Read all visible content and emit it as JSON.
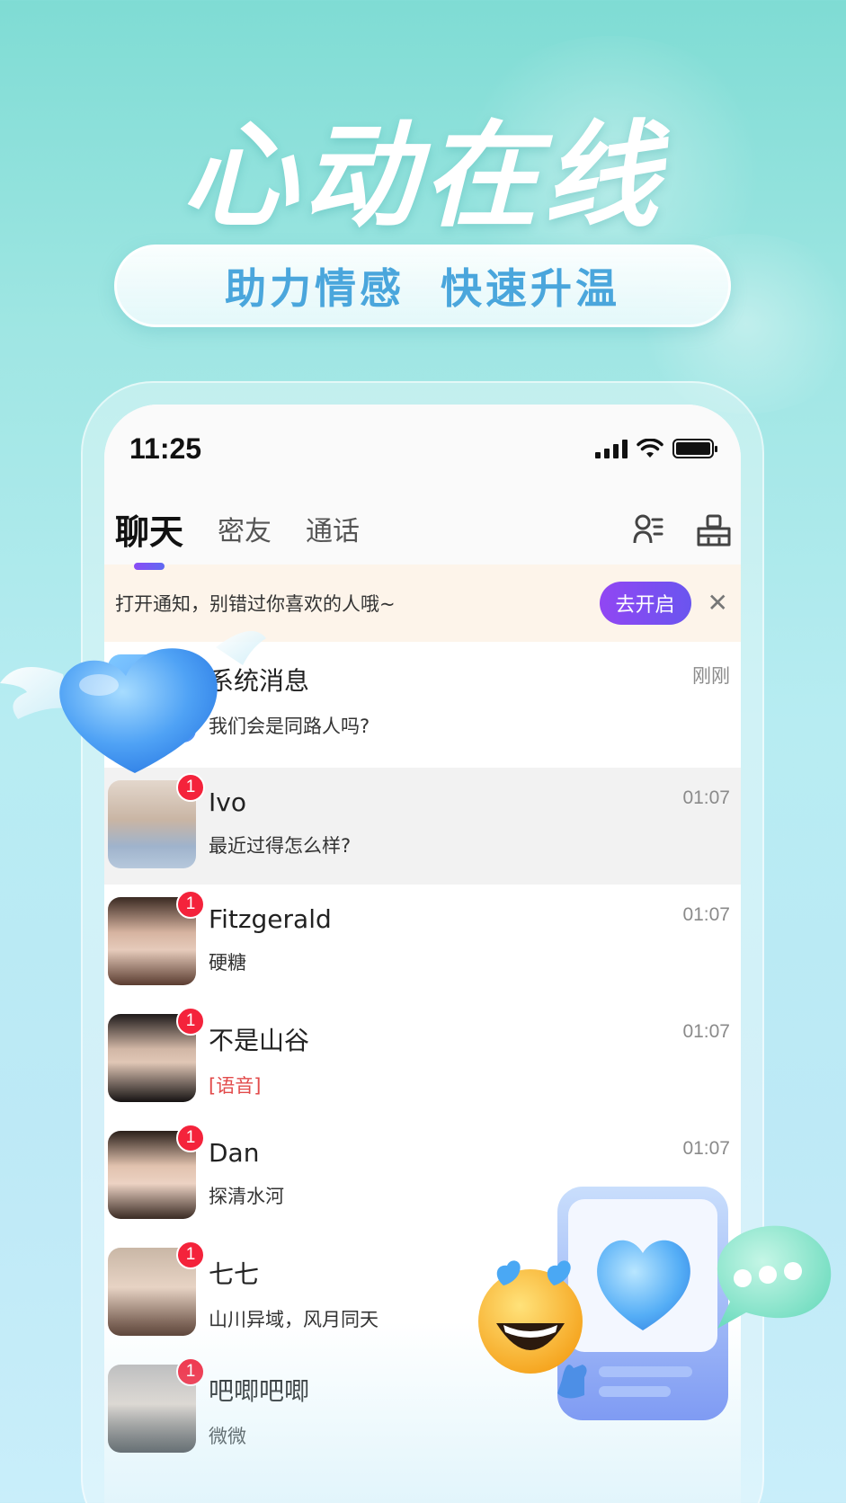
{
  "banner": {
    "headline": "心动在线",
    "subtitle": "助力情感  快速升温"
  },
  "status_bar": {
    "time": "11:25"
  },
  "tabs": [
    {
      "label": "聊天",
      "active": true
    },
    {
      "label": "密友",
      "active": false
    },
    {
      "label": "通话",
      "active": false
    }
  ],
  "tab_icons": [
    "contacts-icon",
    "broom-icon"
  ],
  "notify_bar": {
    "text": "打开通知，别错过你喜欢的人哦~",
    "button_label": "去开启",
    "close_icon": "close-icon"
  },
  "system_message": {
    "title": "系统消息",
    "message": "我们会是同路人吗?",
    "time": "刚刚"
  },
  "conversations": [
    {
      "name": "Ivo",
      "message": "最近过得怎么样?",
      "time": "01:07",
      "badge": "1"
    },
    {
      "name": "Fitzgerald",
      "message": "硬糖",
      "time": "01:07",
      "badge": "1"
    },
    {
      "name": "不是山谷",
      "message": "[语音]",
      "time": "01:07",
      "badge": "1"
    },
    {
      "name": "Dan",
      "message": "探清水河",
      "time": "01:07",
      "badge": "1"
    },
    {
      "name": "七七",
      "message": "山川异域，风月同天",
      "time": "",
      "badge": "1"
    },
    {
      "name": "吧唧吧唧",
      "message": "微微",
      "time": "",
      "badge": "1"
    }
  ],
  "colors": {
    "accent_purple": "#8a4cf5",
    "badge_red": "#f4233b",
    "subtitle_blue": "#4aa6dc",
    "notify_bg": "#fdf4ea"
  }
}
